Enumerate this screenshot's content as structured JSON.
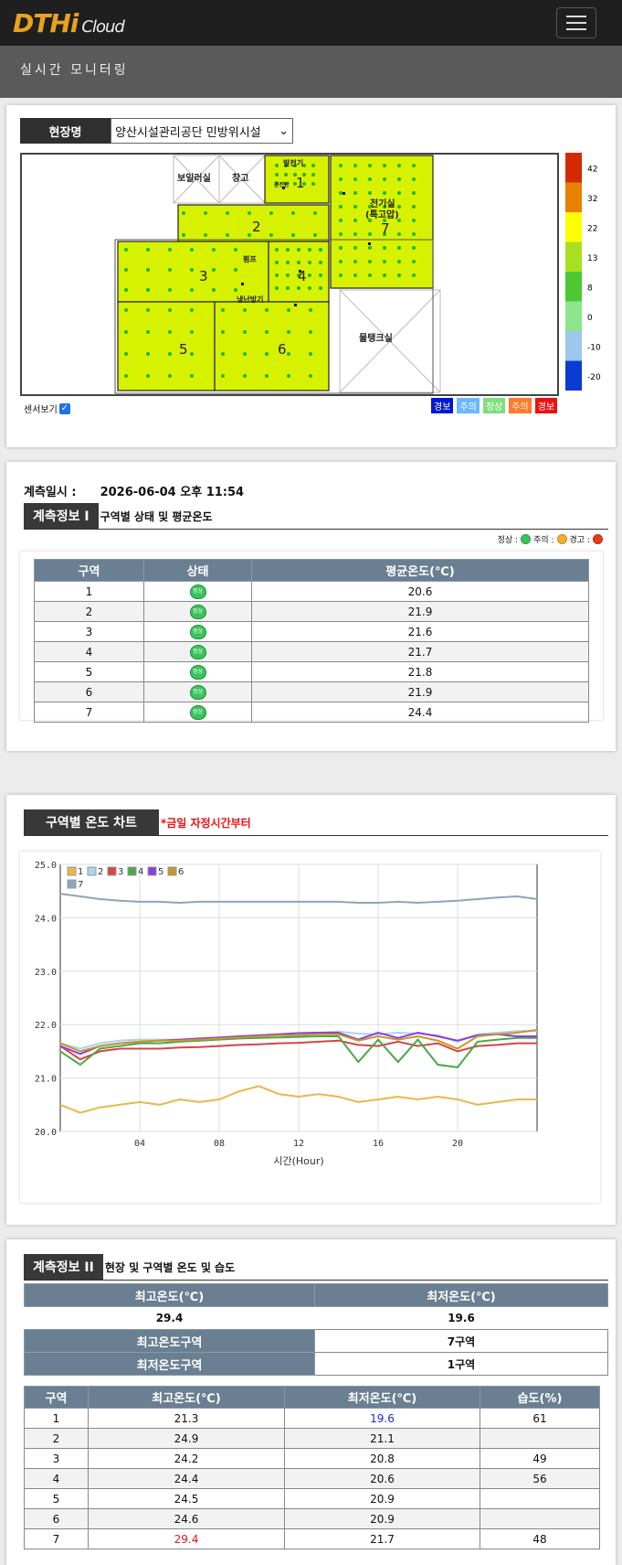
{
  "header": {
    "logo_text": "DTHi",
    "logo_sub": "Cloud",
    "menu_icon": "hamburger-icon"
  },
  "subheader": {
    "title": "실시간 모니터링"
  },
  "site": {
    "label": "현장명",
    "selected": "양산시설관리공단 민방위시설"
  },
  "map": {
    "rooms": {
      "boiler": "보일러실",
      "storage": "창고",
      "generator": "발전기",
      "gen_small": "운전반",
      "electric1": "전기실",
      "electric2": "(특고압)",
      "pump": "펌프",
      "cooling": "냉난방기",
      "water": "물탱크실"
    },
    "zones": [
      "1",
      "2",
      "3",
      "4",
      "5",
      "6",
      "7"
    ],
    "zone_color": "#d6f200",
    "scale_labels": [
      "42",
      "32",
      "22",
      "13",
      "8",
      "0",
      "-10",
      "-20"
    ],
    "scale_colors": [
      "#d42a00",
      "#e88000",
      "#ffff00",
      "#a8e020",
      "#4cc832",
      "#8ce68c",
      "#9cc8f0",
      "#0a3cd2"
    ],
    "sensor_toggle_label": "센서보기",
    "status_legend": [
      {
        "label": "경보",
        "color": "#0018d0"
      },
      {
        "label": "주의",
        "color": "#6ab8ff"
      },
      {
        "label": "정상",
        "color": "#7de07d"
      },
      {
        "label": "주의",
        "color": "#ff7a2a"
      },
      {
        "label": "경보",
        "color": "#ee1111"
      }
    ]
  },
  "measure": {
    "label": "계측일시 :",
    "datetime": "2026-06-04 오후 11:54"
  },
  "info1": {
    "tag": "계측정보 I",
    "desc": "구역별 상태 및 평균온도",
    "key": {
      "normal": "정상 :",
      "caution": "주의 :",
      "warning": "경고 :"
    },
    "headers": [
      "구역",
      "상태",
      "평균온도(℃)"
    ],
    "status_icon_text": "정상",
    "rows": [
      {
        "zone": "1",
        "avg": "20.6"
      },
      {
        "zone": "2",
        "avg": "21.9"
      },
      {
        "zone": "3",
        "avg": "21.6"
      },
      {
        "zone": "4",
        "avg": "21.7"
      },
      {
        "zone": "5",
        "avg": "21.8"
      },
      {
        "zone": "6",
        "avg": "21.9"
      },
      {
        "zone": "7",
        "avg": "24.4"
      }
    ]
  },
  "chart_section": {
    "tag": "구역별 온도 차트",
    "note": "*금일 자정시간부터"
  },
  "chart_data": {
    "type": "line",
    "xlabel": "시간(Hour)",
    "ylabel": "",
    "xlim": [
      0,
      24
    ],
    "ylim": [
      20.0,
      25.0
    ],
    "x_ticks": [
      "04",
      "08",
      "12",
      "16",
      "20"
    ],
    "y_ticks": [
      "20.0",
      "21.0",
      "22.0",
      "23.0",
      "24.0",
      "25.0"
    ],
    "grid": true,
    "legend_position": "top-left",
    "x": [
      0,
      1,
      2,
      3,
      4,
      5,
      6,
      7,
      8,
      9,
      10,
      11,
      12,
      13,
      14,
      15,
      16,
      17,
      18,
      19,
      20,
      21,
      22,
      23,
      24
    ],
    "series": [
      {
        "name": "1",
        "color": "#e8b84a",
        "values": [
          20.5,
          20.35,
          20.45,
          20.5,
          20.55,
          20.5,
          20.6,
          20.55,
          20.6,
          20.75,
          20.85,
          20.7,
          20.65,
          20.7,
          20.65,
          20.55,
          20.6,
          20.65,
          20.6,
          20.65,
          20.6,
          20.5,
          20.55,
          20.6,
          20.6
        ]
      },
      {
        "name": "2",
        "color": "#a8d4f0",
        "values": [
          21.65,
          21.55,
          21.65,
          21.7,
          21.72,
          21.72,
          21.72,
          21.73,
          21.75,
          21.78,
          21.8,
          21.82,
          21.84,
          21.85,
          21.87,
          21.83,
          21.82,
          21.85,
          21.83,
          21.8,
          21.68,
          21.82,
          21.85,
          21.88,
          21.88
        ]
      },
      {
        "name": "3",
        "color": "#d64545",
        "values": [
          21.6,
          21.35,
          21.5,
          21.55,
          21.55,
          21.55,
          21.57,
          21.58,
          21.6,
          21.62,
          21.63,
          21.65,
          21.66,
          21.68,
          21.7,
          21.62,
          21.6,
          21.68,
          21.6,
          21.65,
          21.5,
          21.6,
          21.62,
          21.65,
          21.65
        ]
      },
      {
        "name": "4",
        "color": "#4aa84a",
        "values": [
          21.5,
          21.25,
          21.55,
          21.6,
          21.65,
          21.65,
          21.68,
          21.7,
          21.72,
          21.74,
          21.75,
          21.76,
          21.77,
          21.78,
          21.78,
          21.3,
          21.72,
          21.3,
          21.72,
          21.25,
          21.2,
          21.68,
          21.72,
          21.75,
          21.75
        ]
      },
      {
        "name": "5",
        "color": "#8a40d8",
        "values": [
          21.6,
          21.45,
          21.6,
          21.65,
          21.68,
          21.7,
          21.72,
          21.74,
          21.76,
          21.78,
          21.8,
          21.82,
          21.84,
          21.85,
          21.85,
          21.72,
          21.85,
          21.75,
          21.85,
          21.78,
          21.7,
          21.8,
          21.82,
          21.78,
          21.78
        ]
      },
      {
        "name": "6",
        "color": "#c89628",
        "values": [
          21.65,
          21.5,
          21.6,
          21.65,
          21.68,
          21.7,
          21.7,
          21.72,
          21.74,
          21.76,
          21.78,
          21.8,
          21.8,
          21.82,
          21.82,
          21.7,
          21.78,
          21.72,
          21.78,
          21.7,
          21.55,
          21.78,
          21.82,
          21.85,
          21.9
        ]
      },
      {
        "name": "7",
        "color": "#8fa6b8",
        "values": [
          24.45,
          24.4,
          24.35,
          24.32,
          24.3,
          24.3,
          24.28,
          24.3,
          24.3,
          24.3,
          24.3,
          24.3,
          24.3,
          24.3,
          24.3,
          24.28,
          24.28,
          24.3,
          24.28,
          24.3,
          24.32,
          24.35,
          24.38,
          24.4,
          24.35
        ]
      }
    ]
  },
  "info2": {
    "tag": "계측정보 II",
    "desc": "현장 및 구역별 온도 및 습도",
    "max_label": "최고온도(℃)",
    "min_label": "최저온도(℃)",
    "max_value": "29.4",
    "min_value": "19.6",
    "max_zone_label": "최고온도구역",
    "max_zone_value": "7구역",
    "min_zone_label": "최저온도구역",
    "min_zone_value": "1구역",
    "headers": [
      "구역",
      "최고온도(℃)",
      "최저온도(℃)",
      "습도(%)"
    ],
    "rows": [
      {
        "zone": "1",
        "max": "21.3",
        "min": "19.6",
        "hum": "61"
      },
      {
        "zone": "2",
        "max": "24.9",
        "min": "21.1",
        "hum": ""
      },
      {
        "zone": "3",
        "max": "24.2",
        "min": "20.8",
        "hum": "49"
      },
      {
        "zone": "4",
        "max": "24.4",
        "min": "20.6",
        "hum": "56"
      },
      {
        "zone": "5",
        "max": "24.5",
        "min": "20.9",
        "hum": ""
      },
      {
        "zone": "6",
        "max": "24.6",
        "min": "20.9",
        "hum": ""
      },
      {
        "zone": "7",
        "max": "29.4",
        "min": "21.7",
        "hum": "48"
      }
    ]
  }
}
